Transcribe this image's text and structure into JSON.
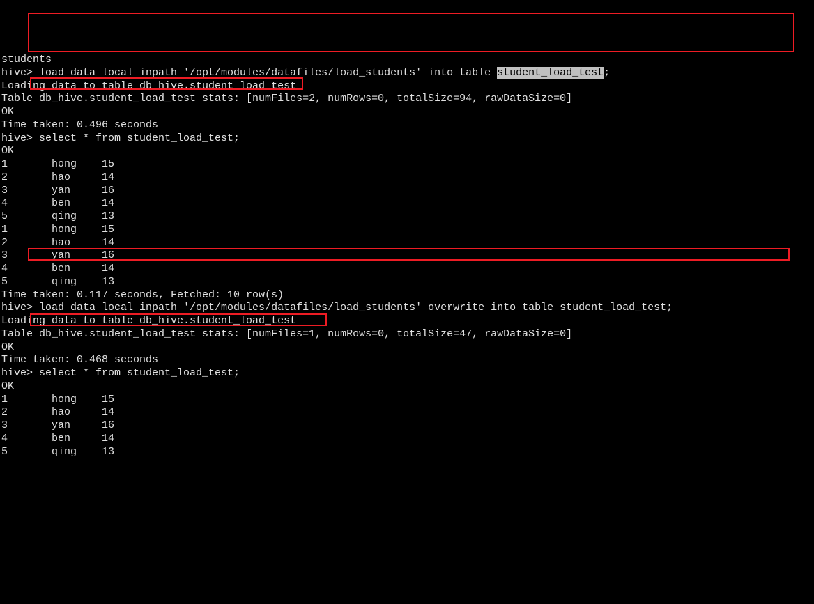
{
  "header_line": "students",
  "block1": {
    "prompt": "hive>",
    "cmd_prefix": " load data local inpath '/opt/modules/datafiles/load_students' into table ",
    "cmd_highlight": "student_load_test",
    "cmd_suffix": ";",
    "out_loading": "Loading data to table db_hive.student_load_test",
    "out_stats": "Table db_hive.student_load_test stats: [numFiles=2, numRows=0, totalSize=94, rawDataSize=0]",
    "ok": "OK",
    "time": "Time taken: 0.496 seconds"
  },
  "block2": {
    "prompt": "hive>",
    "cmd": " select * from student_load_test;",
    "ok": "OK",
    "rows": [
      "1       hong    15",
      "2       hao     14",
      "3       yan     16",
      "4       ben     14",
      "5       qing    13",
      "1       hong    15",
      "2       hao     14",
      "3       yan     16",
      "4       ben     14",
      "5       qing    13"
    ],
    "time": "Time taken: 0.117 seconds, Fetched: 10 row(s)"
  },
  "block3": {
    "prompt": "hive>",
    "cmd": " load data local inpath '/opt/modules/datafiles/load_students' overwrite into table student_load_test;",
    "out_loading": "Loading data to table db_hive.student_load_test",
    "out_stats": "Table db_hive.student_load_test stats: [numFiles=1, numRows=0, totalSize=47, rawDataSize=0]",
    "ok": "OK",
    "time": "Time taken: 0.468 seconds"
  },
  "block4": {
    "prompt": "hive>",
    "cmd": " select * from student_load_test;",
    "ok": "OK",
    "rows": [
      "1       hong    15",
      "2       hao     14",
      "3       yan     16",
      "4       ben     14",
      "5       qing    13"
    ]
  }
}
